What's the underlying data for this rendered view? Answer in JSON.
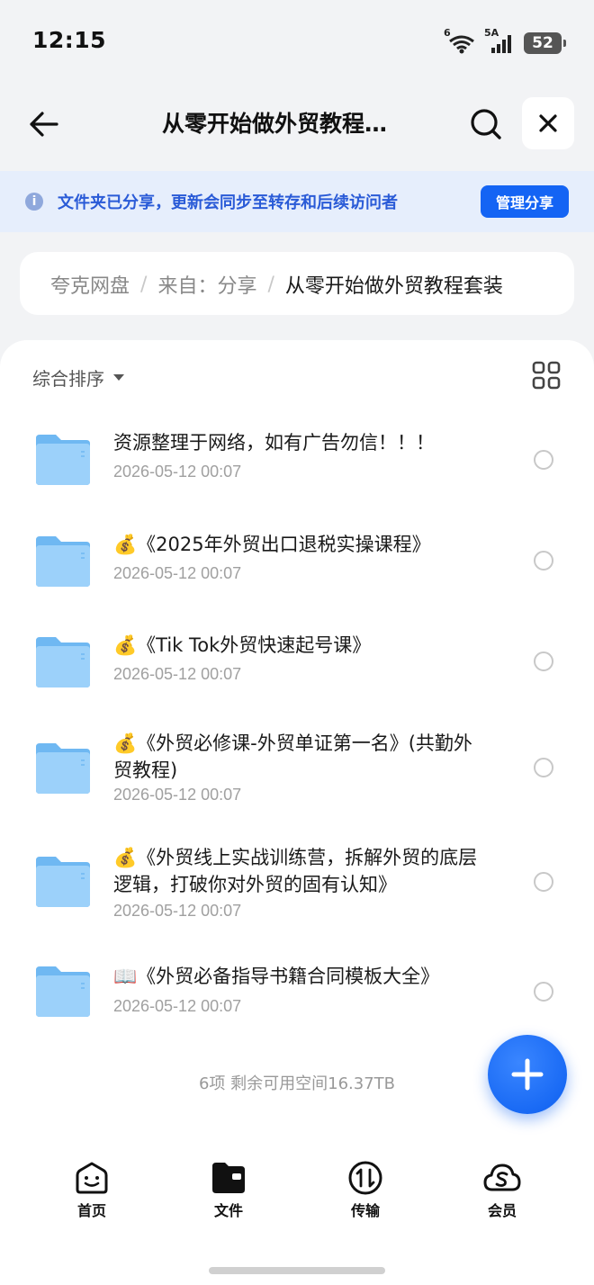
{
  "status_bar": {
    "time": "12:15",
    "wifi_label": "6",
    "signal_label": "5A",
    "battery": "52"
  },
  "nav": {
    "title": "从零开始做外贸教程…"
  },
  "banner": {
    "text": "文件夹已分享，更新会同步至转存和后续访问者",
    "manage_label": "管理分享"
  },
  "breadcrumb": {
    "items": [
      "夸克网盘",
      "来自：分享",
      "从零开始做外贸教程套装"
    ]
  },
  "list": {
    "sort_label": "综合排序",
    "files": [
      {
        "name": "资源整理于网络，如有广告勿信！！！",
        "date": "2026-05-12 00:07"
      },
      {
        "name": "💰《2025年外贸出口退税实操课程》",
        "date": "2026-05-12 00:07"
      },
      {
        "name": "💰《Tik Tok外贸快速起号课》",
        "date": "2026-05-12 00:07"
      },
      {
        "name": "💰《外贸必修课-外贸单证第一名》(共勤外贸教程)",
        "date": "2026-05-12 00:07"
      },
      {
        "name": "💰《外贸线上实战训练营，拆解外贸的底层逻辑，打破你对外贸的固有认知》",
        "date": "2026-05-12 00:07"
      },
      {
        "name": "📖《外贸必备指导书籍合同模板大全》",
        "date": "2026-05-12 00:07"
      }
    ],
    "summary": "6项 剩余可用空间16.37TB"
  },
  "bottom_nav": {
    "tabs": [
      {
        "label": "首页",
        "icon": "home-face-icon"
      },
      {
        "label": "文件",
        "icon": "folder-icon"
      },
      {
        "label": "传输",
        "icon": "transfer-icon"
      },
      {
        "label": "会员",
        "icon": "member-cloud-icon"
      }
    ]
  },
  "colors": {
    "accent": "#1464f4",
    "banner_bg": "#e6eefc",
    "banner_text": "#2a5bd7",
    "folder": "#7cc0f5"
  }
}
